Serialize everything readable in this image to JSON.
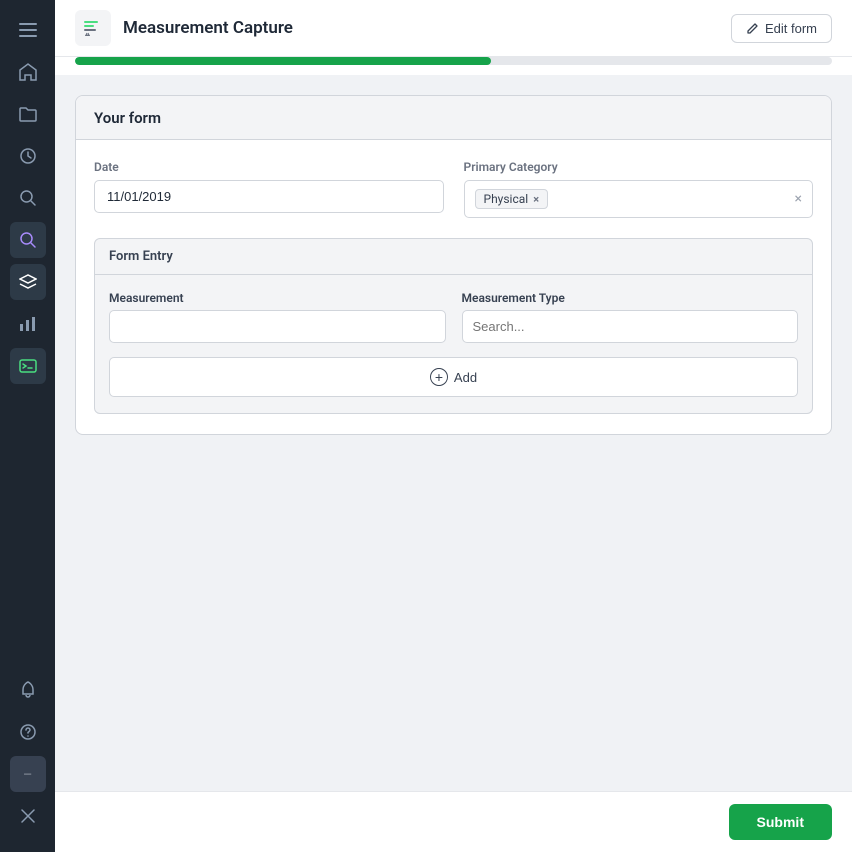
{
  "sidebar": {
    "icons": [
      {
        "name": "menu-icon",
        "symbol": "☰",
        "active": false
      },
      {
        "name": "home-icon",
        "symbol": "⌂",
        "active": false
      },
      {
        "name": "folder-icon",
        "symbol": "❑",
        "active": false
      },
      {
        "name": "history-icon",
        "symbol": "↺",
        "active": false
      },
      {
        "name": "search-icon",
        "symbol": "⚲",
        "active": false
      },
      {
        "name": "search2-icon",
        "symbol": "🔍",
        "active": true,
        "style": "active-purple"
      },
      {
        "name": "layers-icon",
        "symbol": "▤",
        "active": false,
        "style": "active"
      },
      {
        "name": "chart-icon",
        "symbol": "▦",
        "active": false
      },
      {
        "name": "code-icon",
        "symbol": "◫",
        "active": false,
        "style": "active-green"
      }
    ],
    "bottom_icons": [
      {
        "name": "bell-icon",
        "symbol": "🔔"
      },
      {
        "name": "help-icon",
        "symbol": "?"
      },
      {
        "name": "user-icon",
        "symbol": "—"
      },
      {
        "name": "settings-icon",
        "symbol": "✕"
      }
    ]
  },
  "header": {
    "title": "Measurement Capture",
    "edit_form_label": "Edit form"
  },
  "progress": {
    "fill_percent": 55
  },
  "form": {
    "card_title": "Your form",
    "date_label": "Date",
    "date_value": "11/01/2019",
    "primary_category_label": "Primary Category",
    "category_tag": "Physical",
    "form_entry_label": "Form Entry",
    "measurement_label": "Measurement",
    "measurement_value": "",
    "measurement_type_label": "Measurement Type",
    "measurement_type_placeholder": "Search...",
    "add_label": "Add"
  },
  "footer": {
    "submit_label": "Submit"
  }
}
